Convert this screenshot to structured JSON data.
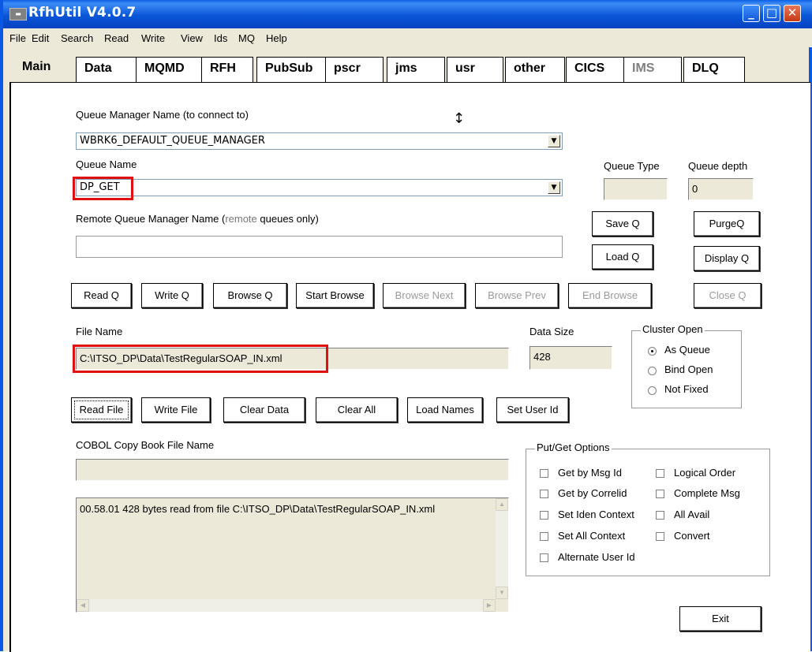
{
  "window": {
    "title": "RfhUtil V4.0.7",
    "icon": "app-icon",
    "controls": [
      "minimize",
      "maximize",
      "close"
    ]
  },
  "menu": [
    "File",
    "Edit",
    "Search",
    "Read",
    "Write",
    "View",
    "Ids",
    "MQ",
    "Help"
  ],
  "tabs": {
    "active": "Main",
    "items": [
      "Data",
      "MQMD",
      "RFH",
      "PubSub",
      "pscr",
      "jms",
      "usr",
      "other",
      "CICS",
      "IMS",
      "DLQ"
    ],
    "disabled": [
      "IMS"
    ]
  },
  "main": {
    "qmgr_label": "Queue Manager Name (to connect to)",
    "qmgr_value": "WBRK6_DEFAULT_QUEUE_MANAGER",
    "queue_label": "Queue Name",
    "queue_value": "DP_GET",
    "queue_type_label": "Queue Type",
    "queue_type_value": "",
    "queue_depth_label": "Queue depth",
    "queue_depth_value": "0",
    "remote_qmgr_label": "Remote Queue Manager Name (",
    "remote_qmgr_label_gray": "remote",
    "remote_qmgr_label_end": " queues only)",
    "remote_qmgr_value": "",
    "buttons": {
      "save_q": "Save Q",
      "purge_q": "PurgeQ",
      "load_q": "Load Q",
      "display_q": "Display Q",
      "read_q": "Read Q",
      "write_q": "Write Q",
      "browse_q": "Browse Q",
      "start_browse": "Start Browse",
      "browse_next": "Browse Next",
      "browse_prev": "Browse Prev",
      "end_browse": "End Browse",
      "close_q": "Close Q",
      "read_file": "Read File",
      "write_file": "Write File",
      "clear_data": "Clear Data",
      "clear_all": "Clear All",
      "load_names": "Load Names",
      "set_user_id": "Set User Id",
      "exit": "Exit"
    },
    "file_name_label": "File Name",
    "file_name_value": "C:\\ITSO_DP\\Data\\TestRegularSOAP_IN.xml",
    "data_size_label": "Data Size",
    "data_size_value": "428",
    "cluster_open": {
      "title": "Cluster Open",
      "options": [
        "As Queue",
        "Bind Open",
        "Not Fixed"
      ],
      "selected": "As Queue"
    },
    "cobol_label": "COBOL Copy Book File Name",
    "cobol_value": "",
    "log_text": "00.58.01 428 bytes read from file C:\\ITSO_DP\\Data\\TestRegularSOAP_IN.xml",
    "put_get": {
      "title": "Put/Get Options",
      "options": [
        "Get by Msg Id",
        "Logical Order",
        "Get by Correlid",
        "Complete Msg",
        "Set Iden Context",
        "All Avail",
        "Set All Context",
        "Convert",
        "Alternate User Id"
      ]
    }
  },
  "colors": {
    "titlebar": "#0a56d8",
    "highlight_box": "#e01010",
    "window_bg": "#ece9d8"
  }
}
